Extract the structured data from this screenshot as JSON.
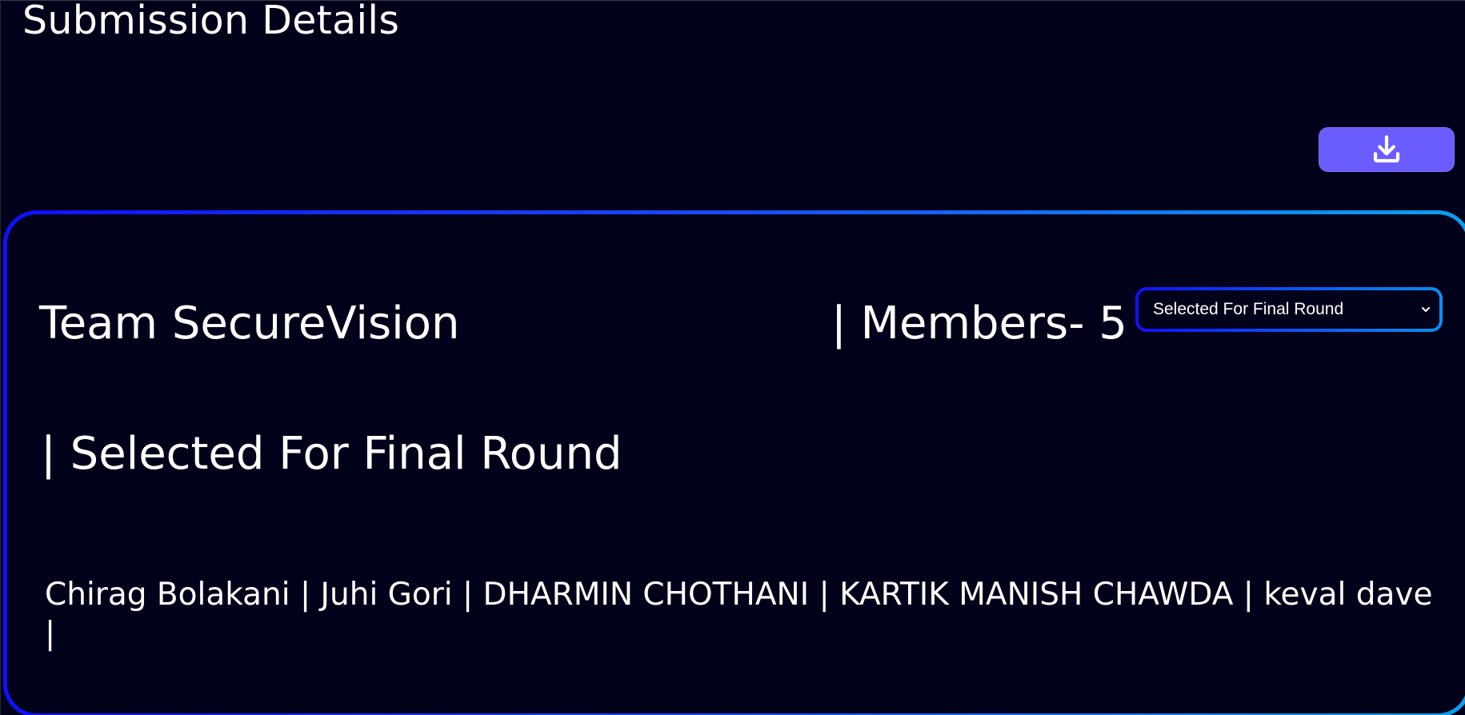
{
  "page": {
    "title": "Submission Details"
  },
  "toolbar": {
    "download_icon": "download-icon"
  },
  "team": {
    "name": "Team SecureVision",
    "members_label": "| Members- 5",
    "status_heading": "| Selected For Final Round",
    "members_list": "Chirag Bolakani | Juhi Gori | DHARMIN CHOTHANI | KARTIK MANISH CHAWDA | keval dave |"
  },
  "status_select": {
    "value": "Selected For Final Round"
  },
  "colors": {
    "background": "#02021a",
    "accent": "#6b5cff",
    "border_gradient_start": "#1010ff",
    "border_gradient_end": "#0a9ff0",
    "text": "#ffffff"
  }
}
